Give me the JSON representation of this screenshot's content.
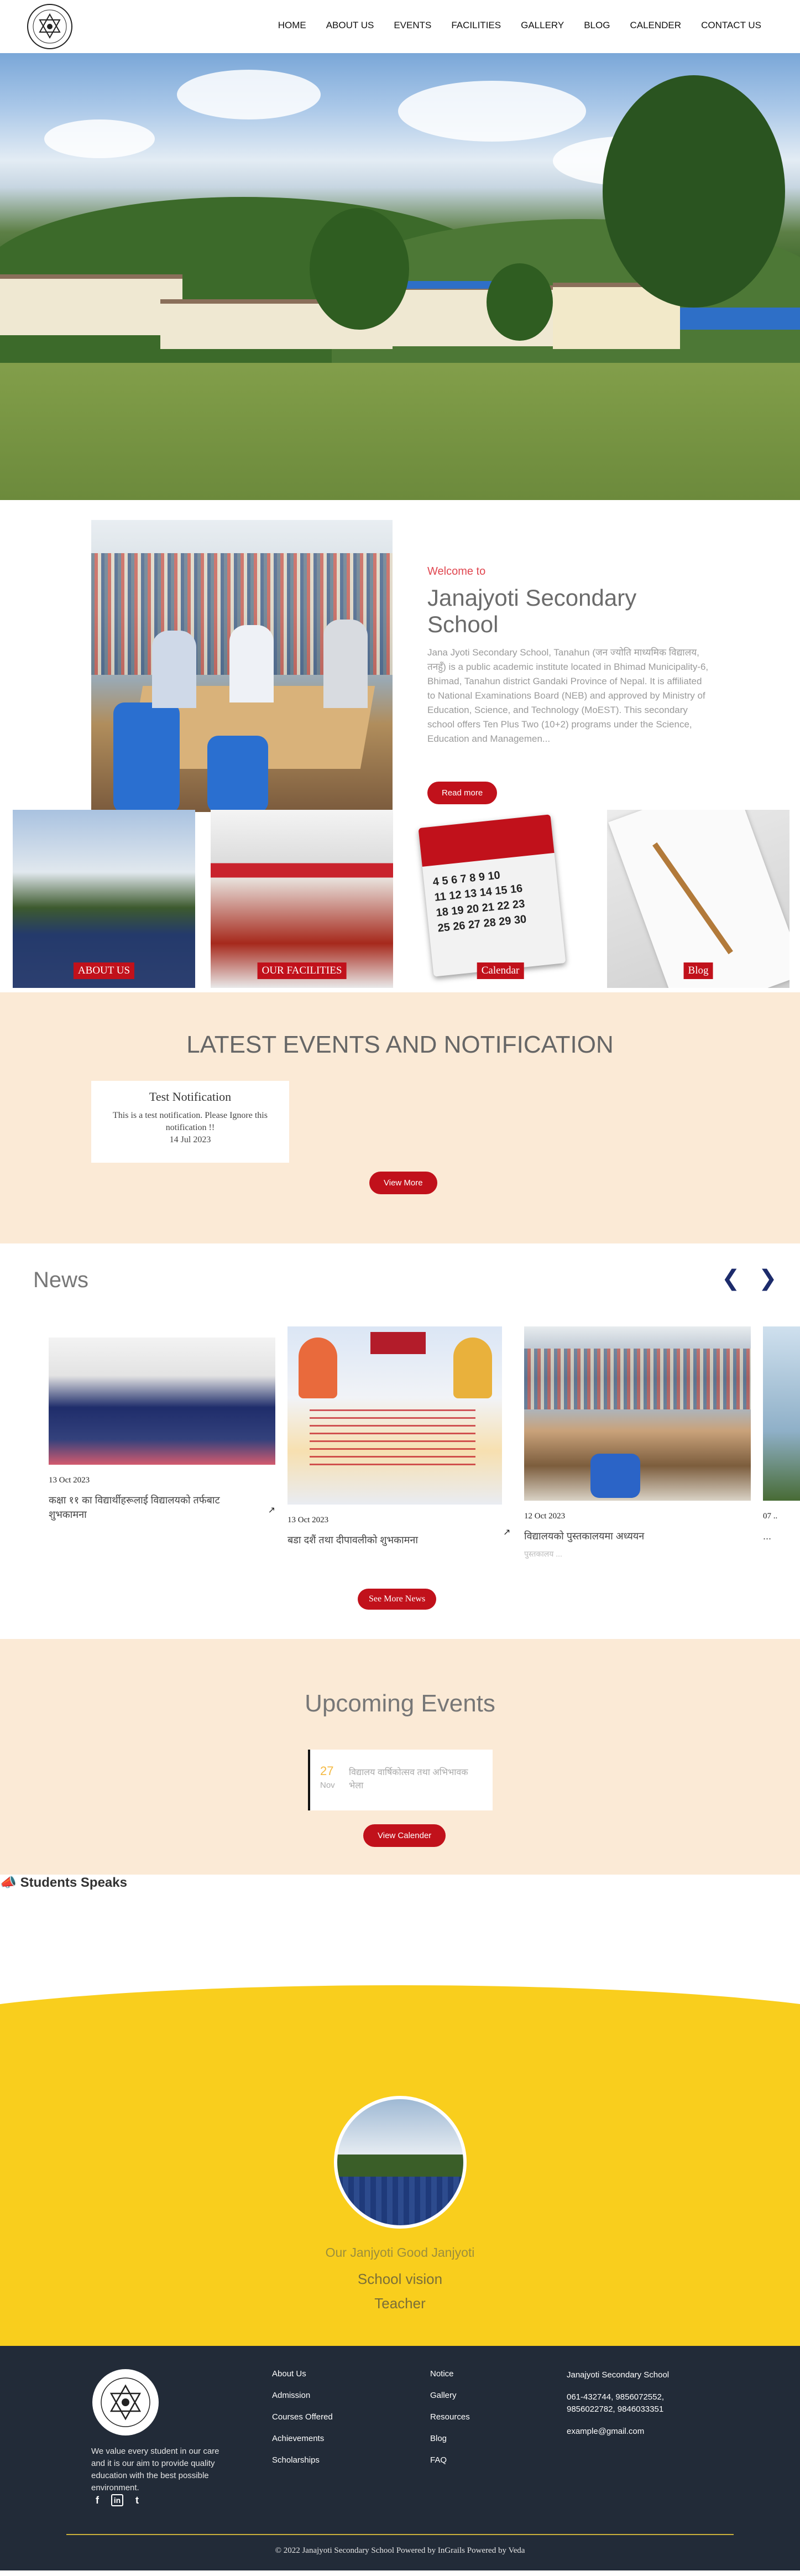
{
  "nav": {
    "items": [
      "HOME",
      "ABOUT US",
      "EVENTS",
      "FACILITIES",
      "GALLERY",
      "BLOG",
      "CALENDER",
      "CONTACT US"
    ]
  },
  "welcome": {
    "pre": "Welcome to",
    "title": "Janajyoti Secondary School",
    "body": "Jana Jyoti Secondary School, Tanahun (जन ज्योति माध्यमिक विद्यालय, तनहुँ) is a public academic institute located in  Bhimad Municipality-6, Bhimad, Tanahun district Gandaki Province of Nepal. It is affiliated to National Examinations Board (NEB) and approved by Ministry of Education, Science, and Technology (MoEST). This secondary school offers  Ten Plus Two (10+2) programs under the Science, Education and Managemen...",
    "button": "Read more"
  },
  "tiles": [
    "ABOUT US",
    "OUR FACILITIES",
    "Calendar",
    "Blog"
  ],
  "latest": {
    "title": "LATEST EVENTS AND NOTIFICATION",
    "card_title": "Test Notification",
    "card_body": "This is a test notification. Please Ignore this notification !!",
    "card_date": "14 Jul 2023",
    "button": "View More"
  },
  "news": {
    "title": "News",
    "prev": "❮",
    "next": "❯",
    "items": [
      {
        "date": "13 Oct 2023",
        "title": "कक्षा ११ का विद्यार्थीहरूलाई विद्यालयको तर्फबाट शुभकामना",
        "sub": ""
      },
      {
        "date": "13 Oct 2023",
        "title": "बडा दशैं तथा दीपावलीको शुभकामना",
        "sub": ""
      },
      {
        "date": "12 Oct 2023",
        "title": "विद्यालयको पुस्तकालयमा अध्ययन",
        "sub": "पुस्तकालय ..."
      },
      {
        "date": "07 ..",
        "title": "...",
        "sub": ""
      }
    ],
    "button": "See More News"
  },
  "upcoming": {
    "title": "Upcoming Events",
    "day": "27",
    "month": "Nov",
    "event": "विद्यालय वार्षिकोत्सव तथा अभिभावक भेला",
    "button": "View Calender"
  },
  "speaks": {
    "title": "Students Speaks",
    "line1": "Our Janjyoti Good Janjyoti",
    "line2": "School vision",
    "line3": "Teacher"
  },
  "footer": {
    "about": "We value every student in our care and it is our aim to provide quality education with the best possible environment.",
    "col1": [
      "About Us",
      "Admission",
      "Courses Offered",
      "Achievements",
      "Scholarships"
    ],
    "col2": [
      "Notice",
      "Gallery",
      "Resources",
      "Blog",
      "FAQ"
    ],
    "school": "Janajyoti Secondary School",
    "phones": "061-432744, 9856072552, 9856022782, 9846033351",
    "email": "example@gmail.com",
    "copyright": "© 2022 Janajyoti Secondary School Powered by InGrails Powered by Veda",
    "social": [
      "f",
      "in",
      "t"
    ]
  },
  "colors": {
    "accent": "#c1111b",
    "cream": "#fbead6",
    "yellow": "#f9ce1d",
    "footer": "#222b38"
  }
}
